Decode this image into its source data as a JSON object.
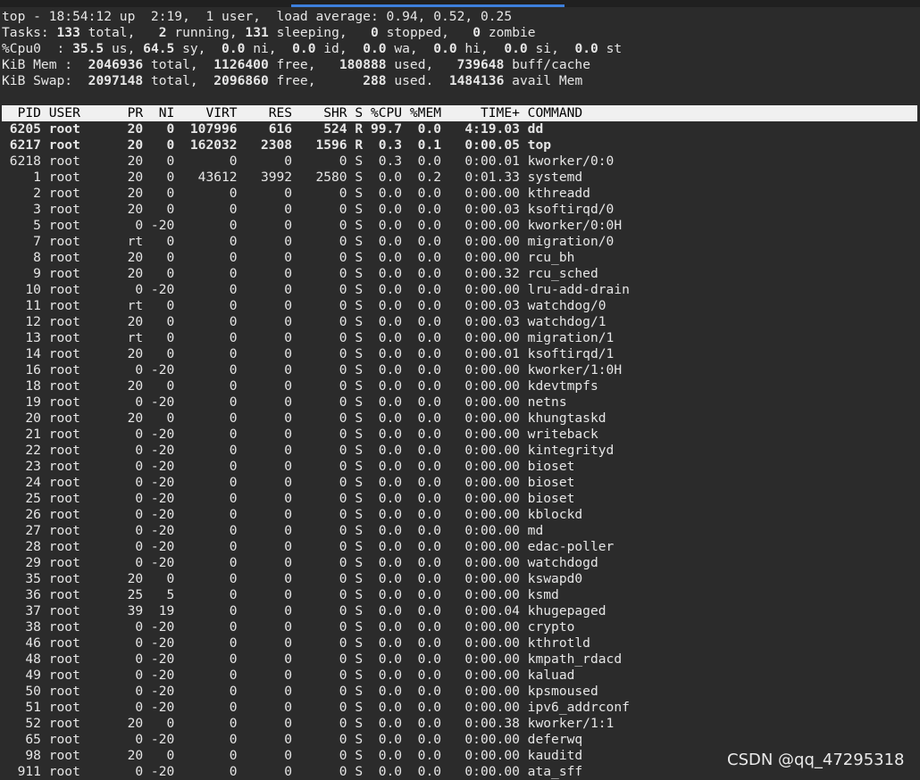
{
  "summary": {
    "line1": "top - 18:54:12 up  2:19,  1 user,  load average: 0.94, 0.52, 0.25",
    "tasks": {
      "prefix": "Tasks: ",
      "total": "133",
      "total_label": " total,   ",
      "running": "2",
      "running_label": " running, ",
      "sleeping": "131",
      "sleeping_label": " sleeping,   ",
      "stopped": "0",
      "stopped_label": " stopped,   ",
      "zombie": "0",
      "zombie_label": " zombie"
    },
    "cpu": {
      "prefix": "%Cpu0  : ",
      "us": "35.5",
      "us_label": " us, ",
      "sy": "64.5",
      "sy_label": " sy,  ",
      "ni": "0.0",
      "ni_label": " ni,  ",
      "id": "0.0",
      "id_label": " id,  ",
      "wa": "0.0",
      "wa_label": " wa,  ",
      "hi": "0.0",
      "hi_label": " hi,  ",
      "si": "0.0",
      "si_label": " si,  ",
      "st": "0.0",
      "st_label": " st"
    },
    "mem": {
      "prefix": "KiB Mem :  ",
      "total": "2046936",
      "total_label": " total,  ",
      "free": "1126400",
      "free_label": " free,   ",
      "used": "180888",
      "used_label": " used,   ",
      "buff": "739648",
      "buff_label": " buff/cache"
    },
    "swap": {
      "prefix": "KiB Swap:  ",
      "total": "2097148",
      "total_label": " total,  ",
      "free": "2096860",
      "free_label": " free,      ",
      "used": "288",
      "used_label": " used.  ",
      "avail": "1484136",
      "avail_label": " avail Mem"
    }
  },
  "table": {
    "header": "  PID USER      PR  NI    VIRT    RES    SHR S %CPU %MEM     TIME+ COMMAND",
    "rows": [
      {
        "text": " 6205 root      20   0  107996    616    524 R 99.7  0.0   4:19.03 dd",
        "bold": true
      },
      {
        "text": " 6217 root      20   0  162032   2308   1596 R  0.3  0.1   0:00.05 top",
        "bold": true
      },
      {
        "text": " 6218 root      20   0       0      0      0 S  0.3  0.0   0:00.01 kworker/0:0",
        "bold": false
      },
      {
        "text": "    1 root      20   0   43612   3992   2580 S  0.0  0.2   0:01.33 systemd",
        "bold": false
      },
      {
        "text": "    2 root      20   0       0      0      0 S  0.0  0.0   0:00.00 kthreadd",
        "bold": false
      },
      {
        "text": "    3 root      20   0       0      0      0 S  0.0  0.0   0:00.03 ksoftirqd/0",
        "bold": false
      },
      {
        "text": "    5 root       0 -20       0      0      0 S  0.0  0.0   0:00.00 kworker/0:0H",
        "bold": false
      },
      {
        "text": "    7 root      rt   0       0      0      0 S  0.0  0.0   0:00.00 migration/0",
        "bold": false
      },
      {
        "text": "    8 root      20   0       0      0      0 S  0.0  0.0   0:00.00 rcu_bh",
        "bold": false
      },
      {
        "text": "    9 root      20   0       0      0      0 S  0.0  0.0   0:00.32 rcu_sched",
        "bold": false
      },
      {
        "text": "   10 root       0 -20       0      0      0 S  0.0  0.0   0:00.00 lru-add-drain",
        "bold": false
      },
      {
        "text": "   11 root      rt   0       0      0      0 S  0.0  0.0   0:00.03 watchdog/0",
        "bold": false
      },
      {
        "text": "   12 root      20   0       0      0      0 S  0.0  0.0   0:00.03 watchdog/1",
        "bold": false
      },
      {
        "text": "   13 root      rt   0       0      0      0 S  0.0  0.0   0:00.00 migration/1",
        "bold": false
      },
      {
        "text": "   14 root      20   0       0      0      0 S  0.0  0.0   0:00.01 ksoftirqd/1",
        "bold": false
      },
      {
        "text": "   16 root       0 -20       0      0      0 S  0.0  0.0   0:00.00 kworker/1:0H",
        "bold": false
      },
      {
        "text": "   18 root      20   0       0      0      0 S  0.0  0.0   0:00.00 kdevtmpfs",
        "bold": false
      },
      {
        "text": "   19 root       0 -20       0      0      0 S  0.0  0.0   0:00.00 netns",
        "bold": false
      },
      {
        "text": "   20 root      20   0       0      0      0 S  0.0  0.0   0:00.00 khungtaskd",
        "bold": false
      },
      {
        "text": "   21 root       0 -20       0      0      0 S  0.0  0.0   0:00.00 writeback",
        "bold": false
      },
      {
        "text": "   22 root       0 -20       0      0      0 S  0.0  0.0   0:00.00 kintegrityd",
        "bold": false
      },
      {
        "text": "   23 root       0 -20       0      0      0 S  0.0  0.0   0:00.00 bioset",
        "bold": false
      },
      {
        "text": "   24 root       0 -20       0      0      0 S  0.0  0.0   0:00.00 bioset",
        "bold": false
      },
      {
        "text": "   25 root       0 -20       0      0      0 S  0.0  0.0   0:00.00 bioset",
        "bold": false
      },
      {
        "text": "   26 root       0 -20       0      0      0 S  0.0  0.0   0:00.00 kblockd",
        "bold": false
      },
      {
        "text": "   27 root       0 -20       0      0      0 S  0.0  0.0   0:00.00 md",
        "bold": false
      },
      {
        "text": "   28 root       0 -20       0      0      0 S  0.0  0.0   0:00.00 edac-poller",
        "bold": false
      },
      {
        "text": "   29 root       0 -20       0      0      0 S  0.0  0.0   0:00.00 watchdogd",
        "bold": false
      },
      {
        "text": "   35 root      20   0       0      0      0 S  0.0  0.0   0:00.00 kswapd0",
        "bold": false
      },
      {
        "text": "   36 root      25   5       0      0      0 S  0.0  0.0   0:00.00 ksmd",
        "bold": false
      },
      {
        "text": "   37 root      39  19       0      0      0 S  0.0  0.0   0:00.04 khugepaged",
        "bold": false
      },
      {
        "text": "   38 root       0 -20       0      0      0 S  0.0  0.0   0:00.00 crypto",
        "bold": false
      },
      {
        "text": "   46 root       0 -20       0      0      0 S  0.0  0.0   0:00.00 kthrotld",
        "bold": false
      },
      {
        "text": "   48 root       0 -20       0      0      0 S  0.0  0.0   0:00.00 kmpath_rdacd",
        "bold": false
      },
      {
        "text": "   49 root       0 -20       0      0      0 S  0.0  0.0   0:00.00 kaluad",
        "bold": false
      },
      {
        "text": "   50 root       0 -20       0      0      0 S  0.0  0.0   0:00.00 kpsmoused",
        "bold": false
      },
      {
        "text": "   51 root       0 -20       0      0      0 S  0.0  0.0   0:00.00 ipv6_addrconf",
        "bold": false
      },
      {
        "text": "   52 root      20   0       0      0      0 S  0.0  0.0   0:00.38 kworker/1:1",
        "bold": false
      },
      {
        "text": "   65 root       0 -20       0      0      0 S  0.0  0.0   0:00.00 deferwq",
        "bold": false
      },
      {
        "text": "   98 root      20   0       0      0      0 S  0.0  0.0   0:00.00 kauditd",
        "bold": false
      },
      {
        "text": "  911 root       0 -20       0      0      0 S  0.0  0.0   0:00.00 ata_sff",
        "bold": false
      }
    ]
  },
  "watermark": "CSDN @qq_47295318"
}
